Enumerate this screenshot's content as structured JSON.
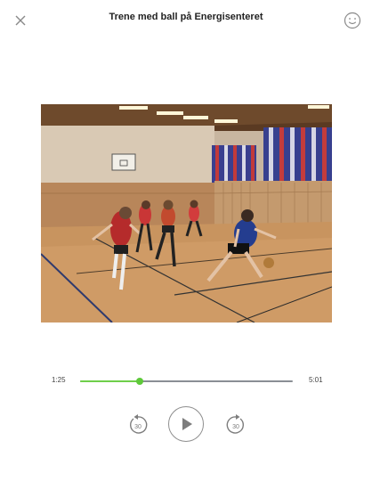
{
  "header": {
    "title": "Trene med ball på Energisenteret",
    "close_icon": "close-icon",
    "mood_icon": "smiley-face-icon"
  },
  "video": {
    "description_icon": "video-frame"
  },
  "player": {
    "elapsed": "1:25",
    "total": "5:01",
    "progress_fraction": 0.282,
    "accent_color": "#5ec93a",
    "skip_back_label": "30",
    "skip_forward_label": "30",
    "skip_back_icon": "rewind-30-icon",
    "play_icon": "play-icon",
    "skip_forward_icon": "forward-30-icon"
  }
}
